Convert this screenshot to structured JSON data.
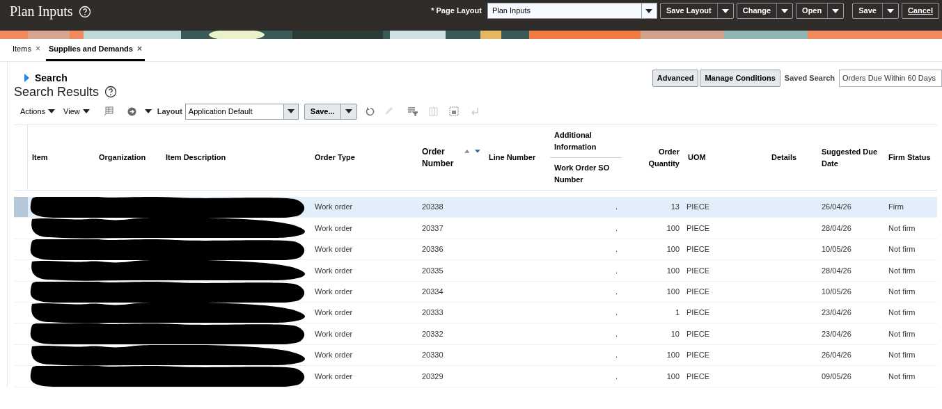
{
  "header": {
    "title": "Plan Inputs",
    "required_mark": "*",
    "page_layout_label": "Page Layout",
    "page_layout_value": "Plan Inputs",
    "buttons": [
      "Save Layout",
      "Change",
      "Open",
      "Save"
    ],
    "cancel": "Cancel"
  },
  "tabs": [
    {
      "label": "Items",
      "selected": false,
      "close": "×"
    },
    {
      "label": "Supplies and Demands",
      "selected": true,
      "close": "×"
    }
  ],
  "search": {
    "label": "Search",
    "expanded": false,
    "advanced": "Advanced",
    "manage": "Manage Conditions",
    "saved_search_label": "Saved Search",
    "saved_search_value": "Orders Due Within 60 Days"
  },
  "results": {
    "title": "Search Results",
    "actions": "Actions",
    "view": "View",
    "layout_label": "Layout",
    "layout_value": "Application Default",
    "save": "Save..."
  },
  "table": {
    "columns": [
      "Item",
      "Organization",
      "Item Description",
      "Order Type",
      "Order Number",
      "Line Number",
      "Additional Information",
      "Order Quantity",
      "UOM",
      "Details",
      "Suggested Due Date",
      "Firm Status"
    ],
    "subcolumn": "Work Order SO Number",
    "rows": [
      {
        "selected": true,
        "order_type": "Work order",
        "order_number": "20338",
        "additional": ".",
        "quantity": "13",
        "uom": "PIECE",
        "due": "26/04/26",
        "firm": "Firm"
      },
      {
        "selected": false,
        "order_type": "Work order",
        "order_number": "20337",
        "additional": ".",
        "quantity": "100",
        "uom": "PIECE",
        "due": "28/04/26",
        "firm": "Not firm"
      },
      {
        "selected": false,
        "order_type": "Work order",
        "order_number": "20336",
        "additional": ".",
        "quantity": "100",
        "uom": "PIECE",
        "due": "10/05/26",
        "firm": "Not firm"
      },
      {
        "selected": false,
        "order_type": "Work order",
        "order_number": "20335",
        "additional": ".",
        "quantity": "100",
        "uom": "PIECE",
        "due": "28/04/26",
        "firm": "Not firm"
      },
      {
        "selected": false,
        "order_type": "Work order",
        "order_number": "20334",
        "additional": ".",
        "quantity": "100",
        "uom": "PIECE",
        "due": "10/05/26",
        "firm": "Not firm"
      },
      {
        "selected": false,
        "order_type": "Work order",
        "order_number": "20333",
        "additional": ".",
        "quantity": "1",
        "uom": "PIECE",
        "due": "23/04/26",
        "firm": "Not firm"
      },
      {
        "selected": false,
        "order_type": "Work order",
        "order_number": "20332",
        "additional": ".",
        "quantity": "10",
        "uom": "PIECE",
        "due": "23/04/26",
        "firm": "Not firm"
      },
      {
        "selected": false,
        "order_type": "Work order",
        "order_number": "20330",
        "additional": ".",
        "quantity": "100",
        "uom": "PIECE",
        "due": "26/04/26",
        "firm": "Not firm"
      },
      {
        "selected": false,
        "order_type": "Work order",
        "order_number": "20329",
        "additional": ".",
        "quantity": "100",
        "uom": "PIECE",
        "due": "09/05/26",
        "firm": "Not firm"
      }
    ]
  }
}
